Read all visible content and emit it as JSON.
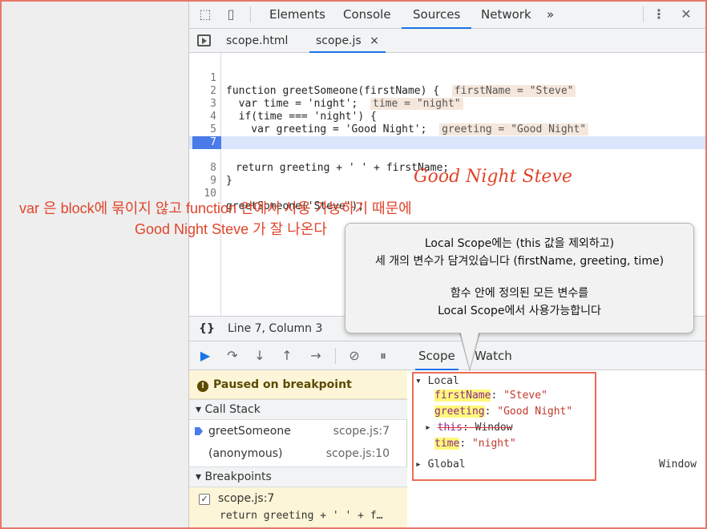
{
  "toolbar": {
    "tabs": [
      "Elements",
      "Console",
      "Sources",
      "Network"
    ],
    "more": "»",
    "menu": "⋮",
    "close": "✕"
  },
  "files": {
    "tab1": "scope.html",
    "tab2": "scope.js",
    "close": "×"
  },
  "code": {
    "l1_a": "function greetSomeone(firstName) {",
    "l1_inline": "firstName = \"Steve\"",
    "l2_a": "  var time = 'night';",
    "l2_inline": "time = \"night\"",
    "l3_a": "  if(time === 'night') {",
    "l4_a": "    var greeting = 'Good Night';",
    "l4_inline": "greeting = \"Good Night\"",
    "l5_a": "  }",
    "l7_a": "return greeting + ' ' + firstName;",
    "l8_a": "}",
    "l10_a": "greetSomeone('Steve');"
  },
  "status": {
    "braces": "{}",
    "position": "Line 7, Column 3"
  },
  "debugger": {
    "paused": "Paused on breakpoint",
    "call_stack": "Call Stack",
    "frames": [
      {
        "name": "greetSomeone",
        "loc": "scope.js:7"
      },
      {
        "name": "(anonymous)",
        "loc": "scope.js:10"
      }
    ],
    "breakpoints": "Breakpoints",
    "bp_file": "scope.js:7",
    "bp_code": "return greeting + ' ' + f…"
  },
  "scope": {
    "tab_scope": "Scope",
    "tab_watch": "Watch",
    "local": "Local",
    "v1_name": "firstName",
    "v1_val": "\"Steve\"",
    "v2_name": "greeting",
    "v2_val": "\"Good Night\"",
    "v3_name": "this",
    "v3_val": "Window",
    "v4_name": "time",
    "v4_val": "\"night\"",
    "global": "Global",
    "global_val": "Window"
  },
  "notes": {
    "handwritten": "Good Night Steve",
    "red_line1": "var 은 block에 묶이지 않고 function 안에서 사용 가능하기 때문에",
    "red_line2": "Good Night Steve 가 잘 나온다",
    "callout_1": "Local Scope에는 (this 값을 제외하고)",
    "callout_2": "세 개의 변수가 담겨있습니다 (firstName, greeting, time)",
    "callout_3": "함수 안에 정의된 모든 변수를",
    "callout_4": "Local Scope에서 사용가능합니다"
  }
}
